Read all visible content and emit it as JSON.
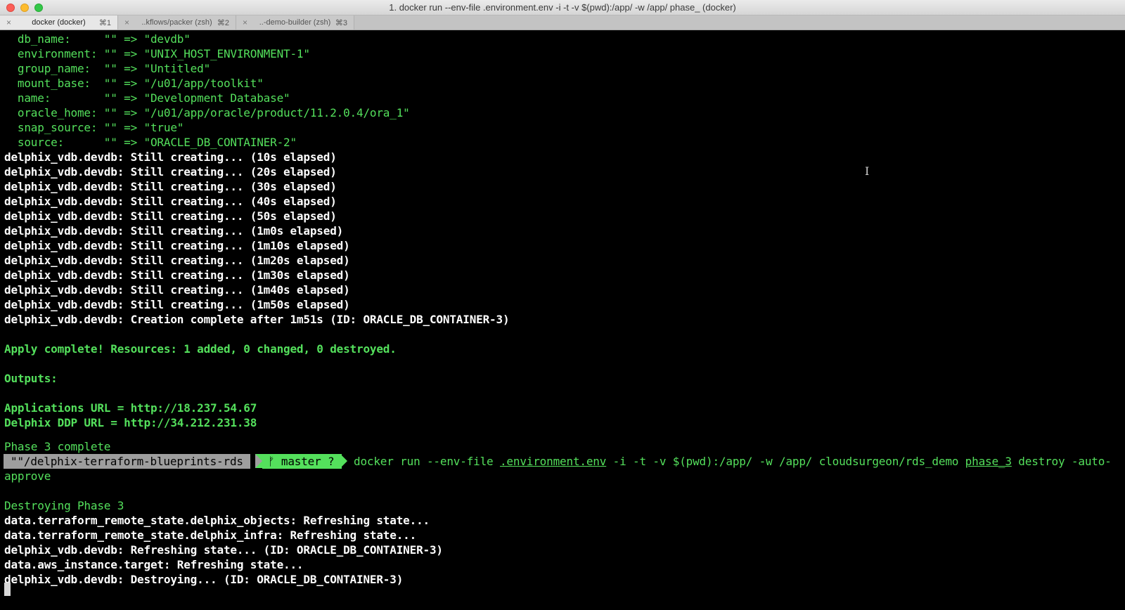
{
  "window": {
    "title": "1. docker run --env-file .environment.env -i -t -v $(pwd):/app/ -w /app/  phase_ (docker)"
  },
  "tabs": [
    {
      "label": "docker (docker)",
      "shortcut": "⌘1",
      "active": true
    },
    {
      "label": "..kflows/packer (zsh)",
      "shortcut": "⌘2",
      "active": false
    },
    {
      "label": "..-demo-builder (zsh)",
      "shortcut": "⌘3",
      "active": false
    }
  ],
  "icons": {
    "close_tab": "×",
    "text_cursor": "I"
  },
  "terminal": {
    "attr_lines": [
      "  db_name:     \"\" => \"devdb\"",
      "  environment: \"\" => \"UNIX_HOST_ENVIRONMENT-1\"",
      "  group_name:  \"\" => \"Untitled\"",
      "  mount_base:  \"\" => \"/u01/app/toolkit\"",
      "  name:        \"\" => \"Development Database\"",
      "  oracle_home: \"\" => \"/u01/app/oracle/product/11.2.0.4/ora_1\"",
      "  snap_source: \"\" => \"true\"",
      "  source:      \"\" => \"ORACLE_DB_CONTAINER-2\""
    ],
    "creating_lines": [
      "delphix_vdb.devdb: Still creating... (10s elapsed)",
      "delphix_vdb.devdb: Still creating... (20s elapsed)",
      "delphix_vdb.devdb: Still creating... (30s elapsed)",
      "delphix_vdb.devdb: Still creating... (40s elapsed)",
      "delphix_vdb.devdb: Still creating... (50s elapsed)",
      "delphix_vdb.devdb: Still creating... (1m0s elapsed)",
      "delphix_vdb.devdb: Still creating... (1m10s elapsed)",
      "delphix_vdb.devdb: Still creating... (1m20s elapsed)",
      "delphix_vdb.devdb: Still creating... (1m30s elapsed)",
      "delphix_vdb.devdb: Still creating... (1m40s elapsed)",
      "delphix_vdb.devdb: Still creating... (1m50s elapsed)",
      "delphix_vdb.devdb: Creation complete after 1m51s (ID: ORACLE_DB_CONTAINER-3)"
    ],
    "apply_complete": "Apply complete! Resources: 1 added, 0 changed, 0 destroyed.",
    "outputs_header": "Outputs:",
    "outputs": [
      "Applications URL = http://18.237.54.67",
      "Delphix DDP URL = http://34.212.231.38"
    ],
    "phase_complete": "Phase 3 complete",
    "prompt": {
      "path": "\"\"/delphix-terraform-blueprints-rds",
      "branch": "ᚠ master ?",
      "cmd_prefix": "docker run --env-file ",
      "cmd_envfile": ".environment.env",
      "cmd_middle": " -i -t -v $(pwd):/app/ -w /app/ cloudsurgeon/rds_demo ",
      "cmd_phase": "phase_3",
      "cmd_suffix": " destroy -auto-",
      "cmd_wrap": "approve"
    },
    "destroying_header": "Destroying Phase 3",
    "destroy_lines": [
      "data.terraform_remote_state.delphix_objects: Refreshing state...",
      "data.terraform_remote_state.delphix_infra: Refreshing state...",
      "delphix_vdb.devdb: Refreshing state... (ID: ORACLE_DB_CONTAINER-3)",
      "data.aws_instance.target: Refreshing state...",
      "delphix_vdb.devdb: Destroying... (ID: ORACLE_DB_CONTAINER-3)"
    ]
  },
  "colors": {
    "terminal_bg": "#000000",
    "green_text": "#54e05c",
    "white_text": "#ffffff",
    "prompt_path_bg": "#9e9e9e",
    "prompt_branch_bg": "#54e05c"
  }
}
